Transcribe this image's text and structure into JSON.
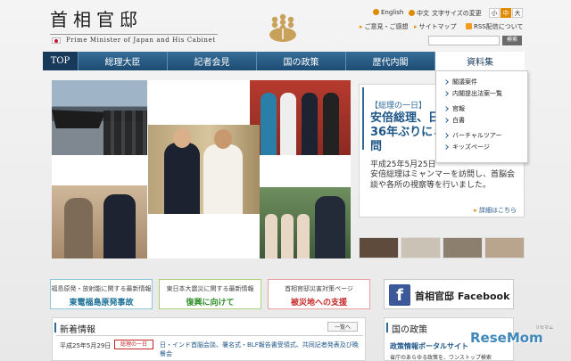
{
  "header": {
    "logo_title": "首相官邸",
    "logo_subtitle": "Prime Minister of Japan and His Cabinet",
    "english": "English",
    "chinese": "中文",
    "font_size_label": "文字サイズの変更",
    "font_sizes": [
      "小",
      "中",
      "大"
    ],
    "feedback": "ご意見・ご感想",
    "sitemap": "サイトマップ",
    "rss": "RSS配信について",
    "search_button": "検索",
    "search_placeholder": ""
  },
  "nav": {
    "items": [
      "TOP",
      "総理大臣",
      "記者会見",
      "国の政策",
      "歴代内閣",
      "資料集"
    ]
  },
  "dropdown": {
    "items": [
      "閣議案件",
      "内閣提出法案一覧",
      "官報",
      "白書",
      "バーチャルツアー",
      "キッズページ"
    ]
  },
  "feature": {
    "tag": "【総理の一日】",
    "headline": "安倍総理、日本の総理として36年ぶりにミャンマーを訪問",
    "date": "平成25年5月25日",
    "body": "安倍総理はミャンマーを訪問し、首脳会談や各所の視察等を行いました。",
    "more": "詳細はこちら"
  },
  "banners": [
    {
      "top": "福島原発・放射能に関する最新情報",
      "main": "東電福島原発事故"
    },
    {
      "top": "東日本大震災に関する最新情報",
      "main": "復興に向けて"
    },
    {
      "top": "首相官邸災害対策ページ",
      "main": "被災地への支援"
    }
  ],
  "facebook": {
    "label": "首相官邸 Facebook"
  },
  "news": {
    "title": "新着情報",
    "view_all": "一覧へ",
    "date": "平成25年5月29日",
    "badge": "総理の一日",
    "text": "日・インド首脳会談、署名式・BLF報告書受領式、共同記者発表及び晩餐会"
  },
  "policy": {
    "title": "国の政策",
    "link": "政策情報ポータルサイト",
    "desc": "省庁のあらゆる政策を、ワンストップ検索"
  },
  "watermark": {
    "text": "ReseMom",
    "sub": "リセマム"
  },
  "colors": {
    "nav": "#1d4c73",
    "accent": "#e08a00",
    "link": "#1f5688",
    "facebook": "#3b5998"
  }
}
